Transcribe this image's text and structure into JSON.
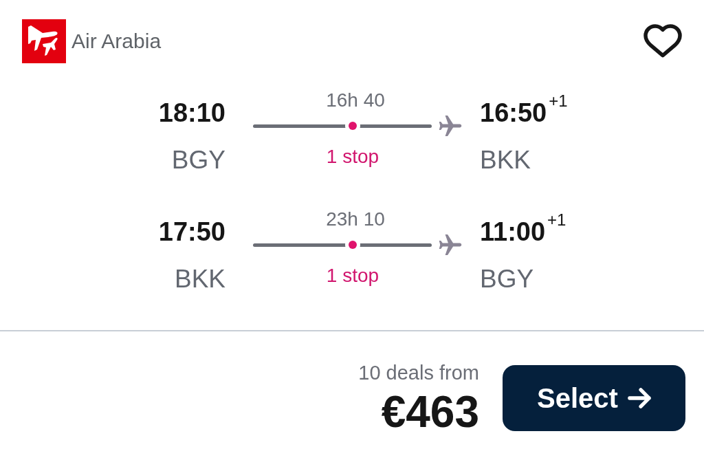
{
  "airline": {
    "name": "Air Arabia"
  },
  "favorite": {
    "saved": false
  },
  "legs": [
    {
      "departure": {
        "time": "18:10",
        "airport": "BGY"
      },
      "duration": "16h 40",
      "stops": "1 stop",
      "arrival": {
        "time": "16:50",
        "day_offset": "+1",
        "airport": "BKK"
      }
    },
    {
      "departure": {
        "time": "17:50",
        "airport": "BKK"
      },
      "duration": "23h 10",
      "stops": "1 stop",
      "arrival": {
        "time": "11:00",
        "day_offset": "+1",
        "airport": "BGY"
      }
    }
  ],
  "price": {
    "deals": "10 deals from",
    "amount": "€463"
  },
  "select_button": {
    "label": "Select"
  }
}
